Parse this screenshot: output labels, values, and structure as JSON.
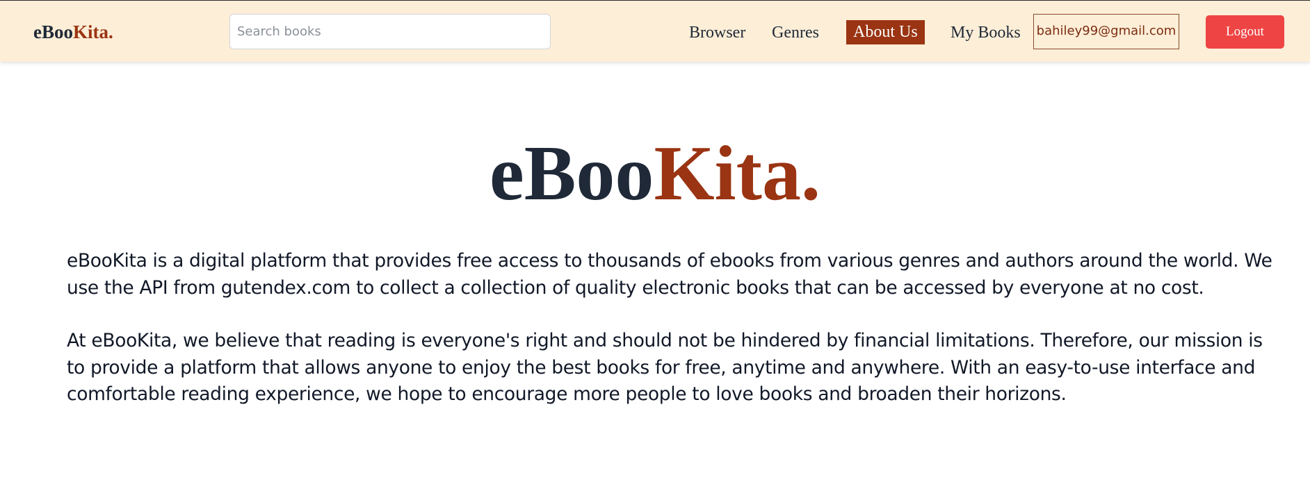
{
  "brand": {
    "part1": "eBoo",
    "part2": "Kita",
    "dot": "."
  },
  "search": {
    "placeholder": "Search books",
    "value": ""
  },
  "nav": {
    "links": [
      "Browser",
      "Genres",
      "About Us",
      "My Books"
    ],
    "active": "About Us",
    "user_email": "bahiley99@gmail.com",
    "logout_label": "Logout"
  },
  "colors": {
    "navbar_bg": "#fdeed7",
    "accent": "#9a3412",
    "dark": "#1f2937",
    "logout": "#ef4444"
  },
  "about": {
    "paragraphs": [
      "eBooKita is a digital platform that provides free access to thousands of ebooks from various genres and authors around the world. We use the API from gutendex.com to collect a collection of quality electronic books that can be accessed by everyone at no cost.",
      "At eBooKita, we believe that reading is everyone's right and should not be hindered by financial limitations. Therefore, our mission is to provide a platform that allows anyone to enjoy the best books for free, anytime and anywhere. With an easy-to-use interface and comfortable reading experience, we hope to encourage more people to love books and broaden their horizons."
    ]
  }
}
